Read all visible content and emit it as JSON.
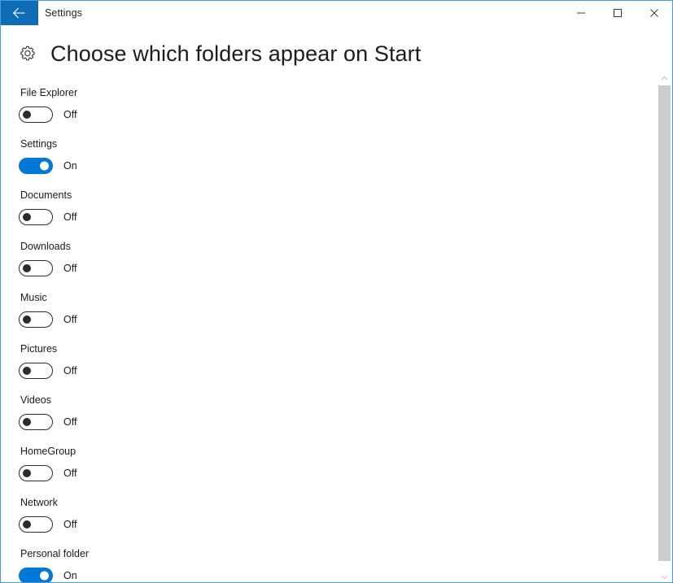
{
  "window": {
    "title": "Settings",
    "back_icon": "arrow-left-icon",
    "controls": {
      "minimize": "minimize-icon",
      "maximize": "maximize-icon",
      "close": "close-icon"
    },
    "accent_color": "#0078d7",
    "titlebar_back_color": "#0d6cb5",
    "border_color": "#4a9ad4"
  },
  "header": {
    "icon": "gear-icon",
    "title": "Choose which folders appear on Start"
  },
  "settings": [
    {
      "label": "File Explorer",
      "state": "Off",
      "on": false
    },
    {
      "label": "Settings",
      "state": "On",
      "on": true
    },
    {
      "label": "Documents",
      "state": "Off",
      "on": false
    },
    {
      "label": "Downloads",
      "state": "Off",
      "on": false
    },
    {
      "label": "Music",
      "state": "Off",
      "on": false
    },
    {
      "label": "Pictures",
      "state": "Off",
      "on": false
    },
    {
      "label": "Videos",
      "state": "Off",
      "on": false
    },
    {
      "label": "HomeGroup",
      "state": "Off",
      "on": false
    },
    {
      "label": "Network",
      "state": "Off",
      "on": false
    },
    {
      "label": "Personal folder",
      "state": "On",
      "on": true
    }
  ],
  "scrollbar": {
    "up_icon": "scroll-up-arrow-icon",
    "down_icon": "scroll-down-arrow-icon"
  }
}
